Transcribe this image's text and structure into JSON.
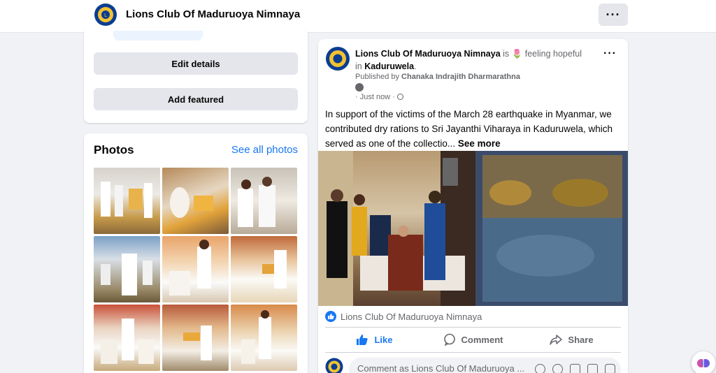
{
  "header": {
    "page_name": "Lions Club Of Maduruoya Nimnaya",
    "more_icon": "more-horizontal-icon",
    "more_label": "···"
  },
  "intro": {
    "edit_details": "Edit details",
    "add_featured": "Add featured"
  },
  "photos": {
    "title": "Photos",
    "see_all": "See all photos"
  },
  "post": {
    "author": "Lions Club Of Maduruoya Nimnaya",
    "is": " is ",
    "feeling": "feeling hopeful",
    "in": "in ",
    "location": "Kaduruwela",
    "published_by_label": "Published by ",
    "publisher": "Chanaka Indrajith Dharmarathna",
    "time": "· Just now ·",
    "text": "In support of the victims of the March 28 earthquake in Myanmar, we contributed dry rations to Sri Jayanthi Viharaya in Kaduruwela, which served as one of the collectio...",
    "see_more": "See more",
    "reaction_name": "Lions Club Of Maduruoya Nimnaya",
    "like_label": "Like",
    "comment_label": "Comment",
    "share_label": "Share",
    "comment_placeholder": "Comment as Lions Club Of Maduruoya ..."
  },
  "colors": {
    "accent": "#1877f2",
    "secondary_text": "#65676b",
    "button_gray": "#e4e6eb",
    "background": "#f0f2f5"
  }
}
